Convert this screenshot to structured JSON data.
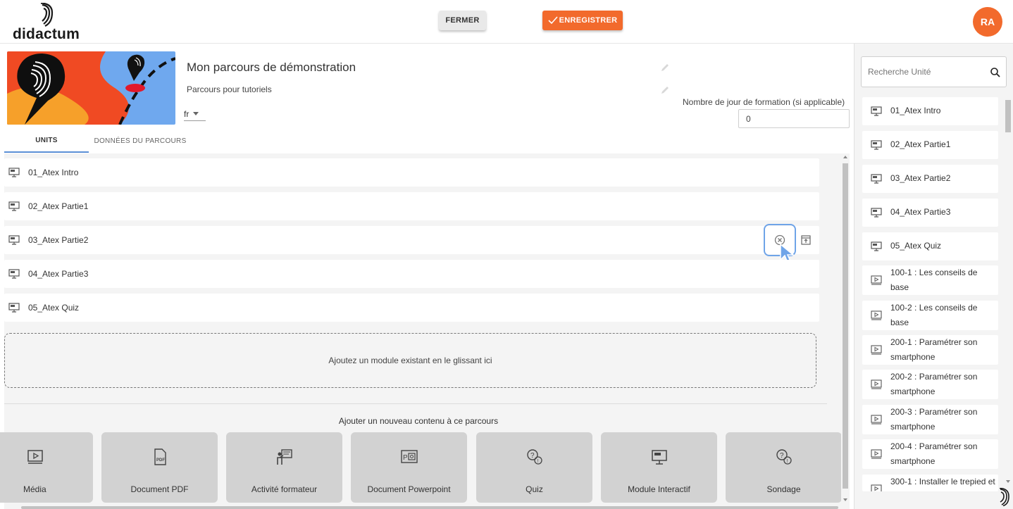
{
  "header": {
    "logo_text": "didactum",
    "close_label": "FERMER",
    "save_label": "ENREGISTRER",
    "avatar_initials": "RA",
    "accent_color": "#f26a2c"
  },
  "course": {
    "title": "Mon parcours de démonstration",
    "subtitle": "Parcours pour tutoriels",
    "language": "fr",
    "days_label": "Nombre de jour de formation (si applicable)",
    "days_value": "0"
  },
  "tabs": [
    {
      "label": "UNITS",
      "active": true
    },
    {
      "label": "DONNÉES DU PARCOURS",
      "active": false
    }
  ],
  "units": [
    {
      "label": "01_Atex Intro",
      "icon": "module-interactive-icon"
    },
    {
      "label": "02_Atex Partie1",
      "icon": "module-interactive-icon"
    },
    {
      "label": "03_Atex Partie2",
      "icon": "module-interactive-icon",
      "hovered": true
    },
    {
      "label": "04_Atex Partie3",
      "icon": "module-interactive-icon"
    },
    {
      "label": "05_Atex Quiz",
      "icon": "module-interactive-icon"
    }
  ],
  "drop_zone_text": "Ajoutez un module existant en le glissant ici",
  "add_content": {
    "title": "Ajouter un nouveau contenu à ce parcours",
    "tiles": [
      {
        "label": "Média",
        "icon": "media-icon"
      },
      {
        "label": "Document PDF",
        "icon": "pdf-icon"
      },
      {
        "label": "Activité formateur",
        "icon": "trainer-activity-icon"
      },
      {
        "label": "Document Powerpoint",
        "icon": "powerpoint-icon"
      },
      {
        "label": "Quiz",
        "icon": "quiz-icon"
      },
      {
        "label": "Module Interactif",
        "icon": "interactive-module-icon"
      },
      {
        "label": "Sondage",
        "icon": "survey-icon"
      }
    ]
  },
  "sidebar": {
    "search_placeholder": "Recherche Unité",
    "items": [
      {
        "label": "01_Atex Intro",
        "icon": "module-interactive-icon"
      },
      {
        "label": "02_Atex Partie1",
        "icon": "module-interactive-icon"
      },
      {
        "label": "03_Atex Partie2",
        "icon": "module-interactive-icon"
      },
      {
        "label": "04_Atex Partie3",
        "icon": "module-interactive-icon"
      },
      {
        "label": "05_Atex Quiz",
        "icon": "module-interactive-icon"
      },
      {
        "label": "100-1 : Les conseils de base",
        "icon": "media-icon"
      },
      {
        "label": "100-2 : Les conseils de base",
        "icon": "media-icon"
      },
      {
        "label": "200-1 : Paramétrer son smartphone",
        "icon": "media-icon"
      },
      {
        "label": "200-2 : Paramétrer son smartphone",
        "icon": "media-icon"
      },
      {
        "label": "200-3 : Paramétrer son smartphone",
        "icon": "media-icon"
      },
      {
        "label": "200-4 : Paramétrer son smartphone",
        "icon": "media-icon"
      },
      {
        "label": "300-1 : Installer le trepied et",
        "icon": "media-icon"
      }
    ]
  }
}
